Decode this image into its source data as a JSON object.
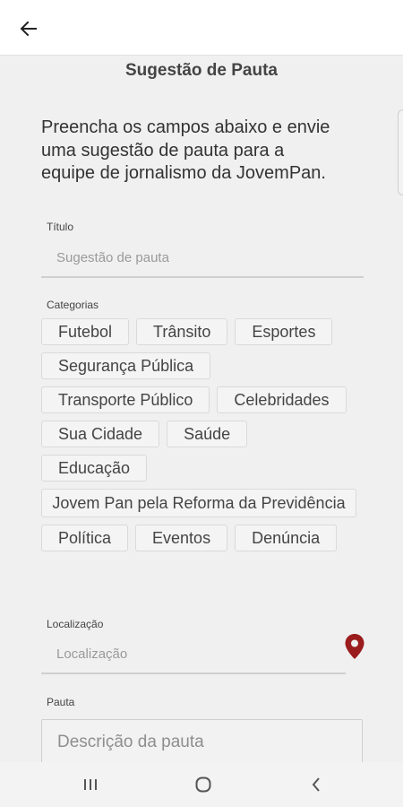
{
  "header": {
    "back_icon": "arrow-left-icon"
  },
  "page": {
    "title": "Sugestão de Pauta"
  },
  "intro": "Preencha os campos abaixo e envie uma sugestão de pauta para a equipe de jornalismo da JovemPan.",
  "titulo": {
    "label": "Título",
    "placeholder": "Sugestão de pauta"
  },
  "categorias": {
    "label": "Categorias",
    "items": [
      "Futebol",
      "Trânsito",
      "Esportes",
      "Segurança Pública",
      "Transporte Público",
      "Celebridades",
      "Sua Cidade",
      "Saúde",
      "Educação",
      "Jovem Pan pela Reforma da Previdência",
      "Política",
      "Eventos",
      "Denúncia"
    ]
  },
  "localizacao": {
    "label": "Localização",
    "placeholder": "Localização",
    "icon": "map-pin-icon",
    "icon_color": "#9b1c1c"
  },
  "pauta": {
    "label": "Pauta",
    "placeholder": "Descrição da pauta"
  },
  "system_nav": {
    "recents_icon": "recents-icon",
    "home_icon": "home-icon",
    "back_icon": "back-chevron-icon"
  }
}
